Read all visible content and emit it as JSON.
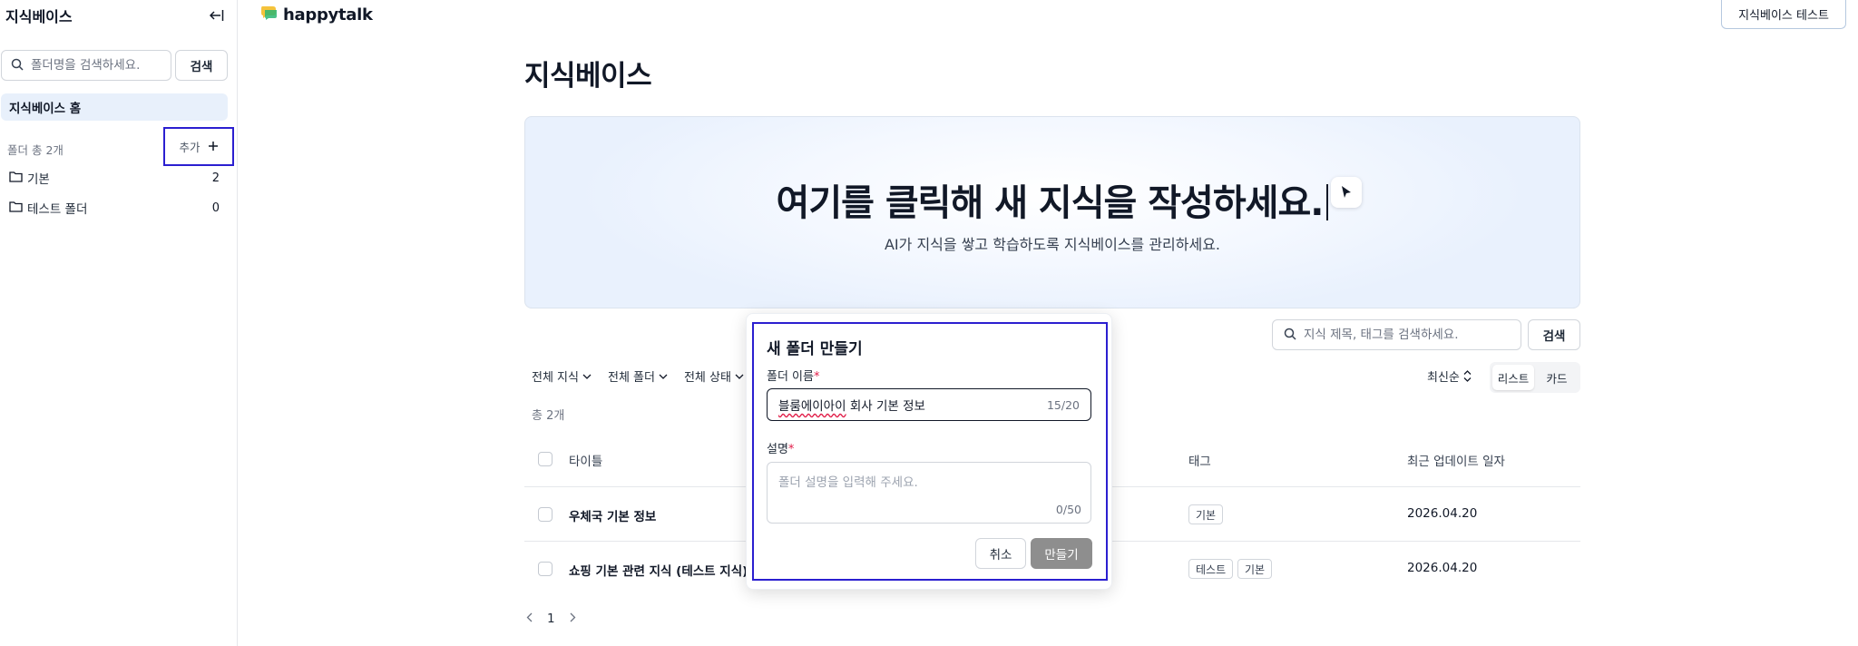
{
  "sidebar": {
    "title": "지식베이스",
    "search_placeholder": "폴더명을 검색하세요.",
    "search_button": "검색",
    "home_label": "지식베이스 홈",
    "folder_count": "폴더 총 2개",
    "add_label": "추가",
    "folders": [
      {
        "name": "기본",
        "count": "2"
      },
      {
        "name": "테스트 폴더",
        "count": "0"
      }
    ]
  },
  "topbar": {
    "logo_text": "happytalk",
    "right_button": "지식베이스 테스트"
  },
  "main": {
    "page_title": "지식베이스",
    "hero": {
      "headline": "여기를 클릭해 새 지식을 작성하세요.",
      "subtitle": "AI가 지식을 쌓고 학습하도록 지식베이스를 관리하세요."
    },
    "search_placeholder": "지식 제목, 태그를 검색하세요.",
    "search_button": "검색",
    "filters": [
      "전체 지식",
      "전체 폴더",
      "전체 상태"
    ],
    "sort_label": "최신순",
    "view_options": [
      "리스트",
      "카드"
    ],
    "total": "총 2개",
    "columns": {
      "title": "타이틀",
      "tags": "태그",
      "updated": "최근 업데이트 일자"
    },
    "rows": [
      {
        "title": "우체국 기본 정보",
        "tags": [
          "기본"
        ],
        "date": "2026.04.20"
      },
      {
        "title": "쇼핑 기본 관련 지식 (테스트 지식)",
        "tags": [
          "테스트",
          "기본"
        ],
        "date": "2026.04.20"
      }
    ],
    "pagination": {
      "page": "1"
    }
  },
  "modal": {
    "title": "새 폴더 만들기",
    "name_label": "폴더 이름",
    "required_mark": "*",
    "name_value_misspelled": "블룸에이아이",
    "name_value_rest": " 회사 기본 정보",
    "name_counter": "15/20",
    "desc_label": "설명",
    "desc_placeholder": "폴더 설명을 입력해 주세요.",
    "desc_counter": "0/50",
    "cancel_button": "취소",
    "create_button": "만들기"
  },
  "colors": {
    "highlight_outline": "#2b1fd0",
    "required": "#e11d48",
    "disabled_button": "#8e8e8e",
    "home_bg": "#e8f0fb"
  }
}
